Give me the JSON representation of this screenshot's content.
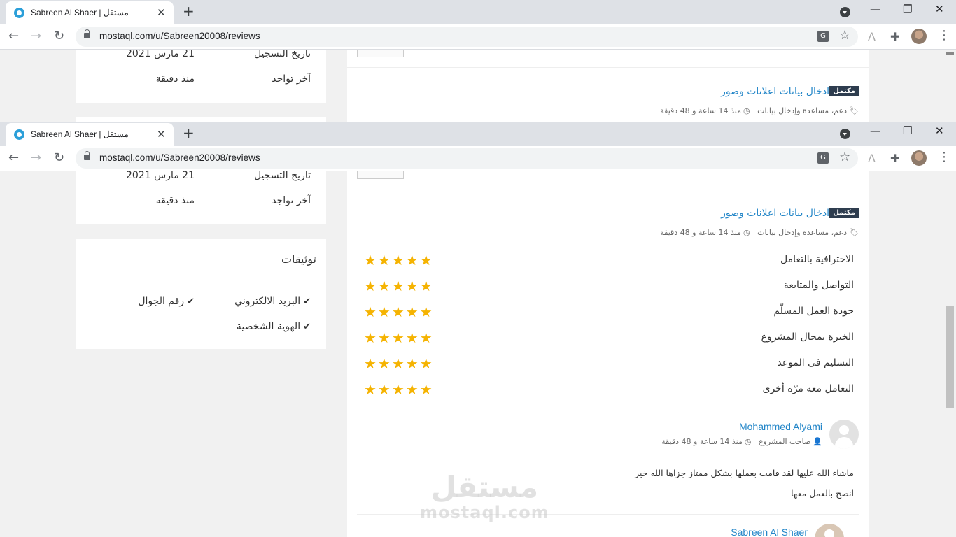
{
  "browser": {
    "tab_title": "Sabreen Al Shaer | مستقل",
    "tab_close": "✕",
    "new_tab": "+",
    "url": "mostaql.com/u/Sabreen20008/reviews",
    "translate_glyph": "G",
    "back": "←",
    "forward": "→",
    "reload": "↻",
    "star": "☆",
    "minimize": "—",
    "restore": "❐",
    "close": "✕",
    "menu": "⋮",
    "puzzle": "✚",
    "ext": "Λ"
  },
  "profile": {
    "registration_label": "تاريخ التسجيل",
    "registration_value": "21 مارس 2021",
    "last_seen_label": "آخر تواجد",
    "last_seen_value": "منذ دقيقة"
  },
  "verifications": {
    "title": "توثيقات",
    "email": "البريد الالكتروني",
    "phone": "رقم الجوال",
    "identity": "الهوية الشخصية",
    "check": "✔"
  },
  "project": {
    "badge": "مكتمل",
    "title": "ادخال بيانات اعلانات وصور",
    "category": "دعم، مساعدة وإدخال بيانات",
    "time": "منذ 14 ساعة و 48 دقيقة"
  },
  "ratings": [
    {
      "label": "الاحترافية بالتعامل",
      "stars": "★★★★★"
    },
    {
      "label": "التواصل والمتابعة",
      "stars": "★★★★★"
    },
    {
      "label": "جودة العمل المسلّم",
      "stars": "★★★★★"
    },
    {
      "label": "الخبرة بمجال المشروع",
      "stars": "★★★★★"
    },
    {
      "label": "التسليم فى الموعد",
      "stars": "★★★★★"
    },
    {
      "label": "التعامل معه مرّة أخرى",
      "stars": "★★★★★"
    }
  ],
  "review": {
    "reviewer_name": "Mohammed Alyami",
    "reviewer_role": "صاحب المشروع",
    "time": "منذ 14 ساعة و 48 دقيقة",
    "line1": "ماشاء الله عليها لقد قامت بعملها بشكل ممتاز جزاها الله خير",
    "line2": "انصح بالعمل معها",
    "reply_name": "Sabreen Al Shaer"
  },
  "watermark": {
    "arabic": "مستقل",
    "latin": "mostaql.com"
  },
  "icons": {
    "tag": "🏷",
    "clock": "◷",
    "user": "👤"
  }
}
